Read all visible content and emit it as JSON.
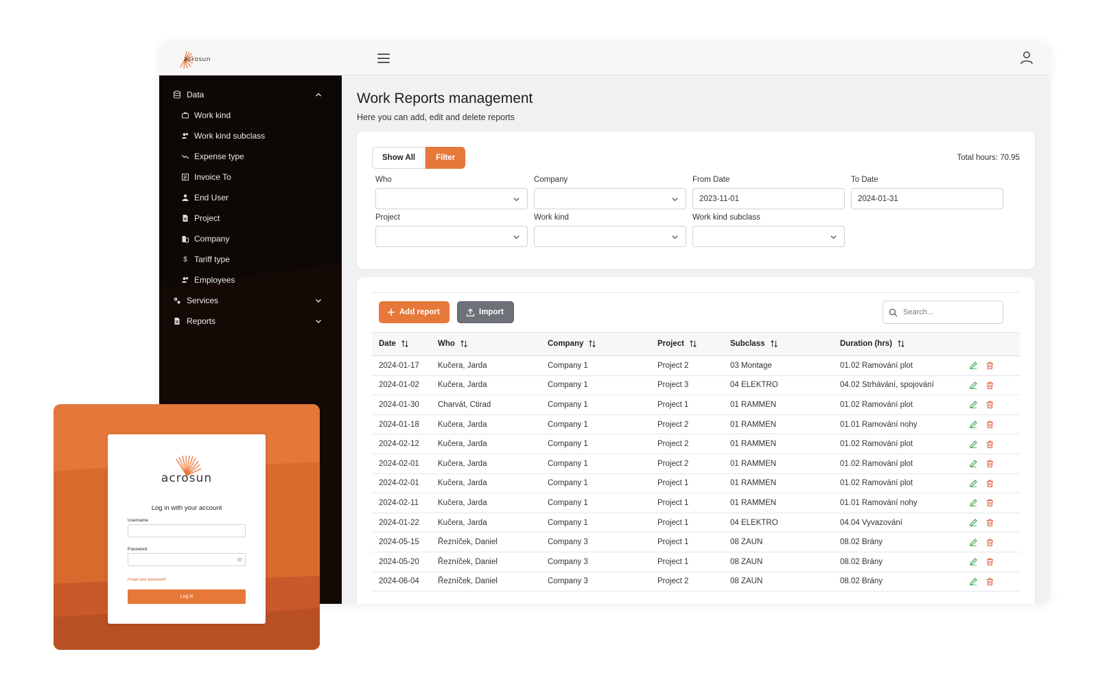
{
  "brand": {
    "name": "acrosun"
  },
  "header": {
    "menu_icon": "hamburger-icon",
    "user_icon": "user-icon"
  },
  "sidebar": {
    "data_group": {
      "label": "Data",
      "icon": "database-icon"
    },
    "items": [
      {
        "label": "Work kind",
        "icon": "briefcase-icon"
      },
      {
        "label": "Work kind subclass",
        "icon": "users-icon"
      },
      {
        "label": "Expense type",
        "icon": "trend-icon"
      },
      {
        "label": "Invoice To",
        "icon": "invoice-icon"
      },
      {
        "label": "End User",
        "icon": "person-icon"
      },
      {
        "label": "Project",
        "icon": "file-icon"
      },
      {
        "label": "Company",
        "icon": "building-icon"
      },
      {
        "label": "Tariff type",
        "icon": "dollar-icon"
      },
      {
        "label": "Employees",
        "icon": "users-icon"
      }
    ],
    "services": {
      "label": "Services",
      "icon": "gears-icon"
    },
    "reports": {
      "label": "Reports",
      "icon": "file-icon"
    }
  },
  "page": {
    "title": "Work Reports management",
    "subtitle": "Here you can add, edit and delete reports"
  },
  "filters": {
    "show_all": "Show All",
    "filter": "Filter",
    "total_hours": "Total hours: 70.95",
    "who": {
      "label": "Who",
      "value": ""
    },
    "company": {
      "label": "Company",
      "value": ""
    },
    "from_date": {
      "label": "From Date",
      "value": "2023-11-01"
    },
    "to_date": {
      "label": "To Date",
      "value": "2024-01-31"
    },
    "project": {
      "label": "Project",
      "value": ""
    },
    "work_kind": {
      "label": "Work kind",
      "value": ""
    },
    "work_kind_subclass": {
      "label": "Work kind subclass",
      "value": ""
    }
  },
  "toolbar": {
    "add_report": "Add report",
    "import": "Import",
    "search_placeholder": "Search..."
  },
  "table": {
    "columns": [
      "Date",
      "Who",
      "Company",
      "Project",
      "Subclass",
      "Duration (hrs)"
    ],
    "rows": [
      [
        "2024-01-17",
        "Kučera, Jarda",
        "Company 1",
        "Project 2",
        "03 Montage",
        "01.02 Ramování plot"
      ],
      [
        "2024-01-02",
        "Kučera, Jarda",
        "Company 1",
        "Project 3",
        "04 ELEKTRO",
        "04.02 Strhávání, spojování"
      ],
      [
        "2024-01-30",
        "Charvát, Ctirad",
        "Company 1",
        "Project 1",
        "01 RAMMEN",
        "01.02 Ramování plot"
      ],
      [
        "2024-01-18",
        "Kučera, Jarda",
        "Company 1",
        "Project 2",
        "01 RAMMEN",
        "01.01 Ramování nohy"
      ],
      [
        "2024-02-12",
        "Kučera, Jarda",
        "Company 1",
        "Project 2",
        "01 RAMMEN",
        "01.02 Ramování plot"
      ],
      [
        "2024-02-01",
        "Kučera, Jarda",
        "Company 1",
        "Project 2",
        "01 RAMMEN",
        "01.02 Ramování plot"
      ],
      [
        "2024-02-01",
        "Kučera, Jarda",
        "Company 1",
        "Project 1",
        "01 RAMMEN",
        "01.02 Ramování plot"
      ],
      [
        "2024-02-11",
        "Kučera, Jarda",
        "Company 1",
        "Project 1",
        "01 RAMMEN",
        "01.01 Ramování nohy"
      ],
      [
        "2024-01-22",
        "Kučera, Jarda",
        "Company 1",
        "Project 1",
        "04 ELEKTRO",
        "04.04 Vyvazování"
      ],
      [
        "2024-05-15",
        "Řezníček, Daniel",
        "Company 3",
        "Project 1",
        "08 ZAUN",
        "08.02 Brány"
      ],
      [
        "2024-05-20",
        "Řezníček, Daniel",
        "Company 3",
        "Project 1",
        "08 ZAUN",
        "08.02 Brány"
      ],
      [
        "2024-06-04",
        "Řezníček, Daniel",
        "Company 3",
        "Project 2",
        "08 ZAUN",
        "08.02 Brány"
      ]
    ]
  },
  "login": {
    "brand": "acrosun",
    "title": "Log in with your account",
    "username_label": "Username",
    "password_label": "Password",
    "forgot": "Forgot your password?",
    "button": "Log in"
  },
  "colors": {
    "accent": "#e6783a",
    "sidebar_bg": "#0d0806",
    "edit_icon": "#3aa14a",
    "delete_icon": "#e05a3a"
  }
}
